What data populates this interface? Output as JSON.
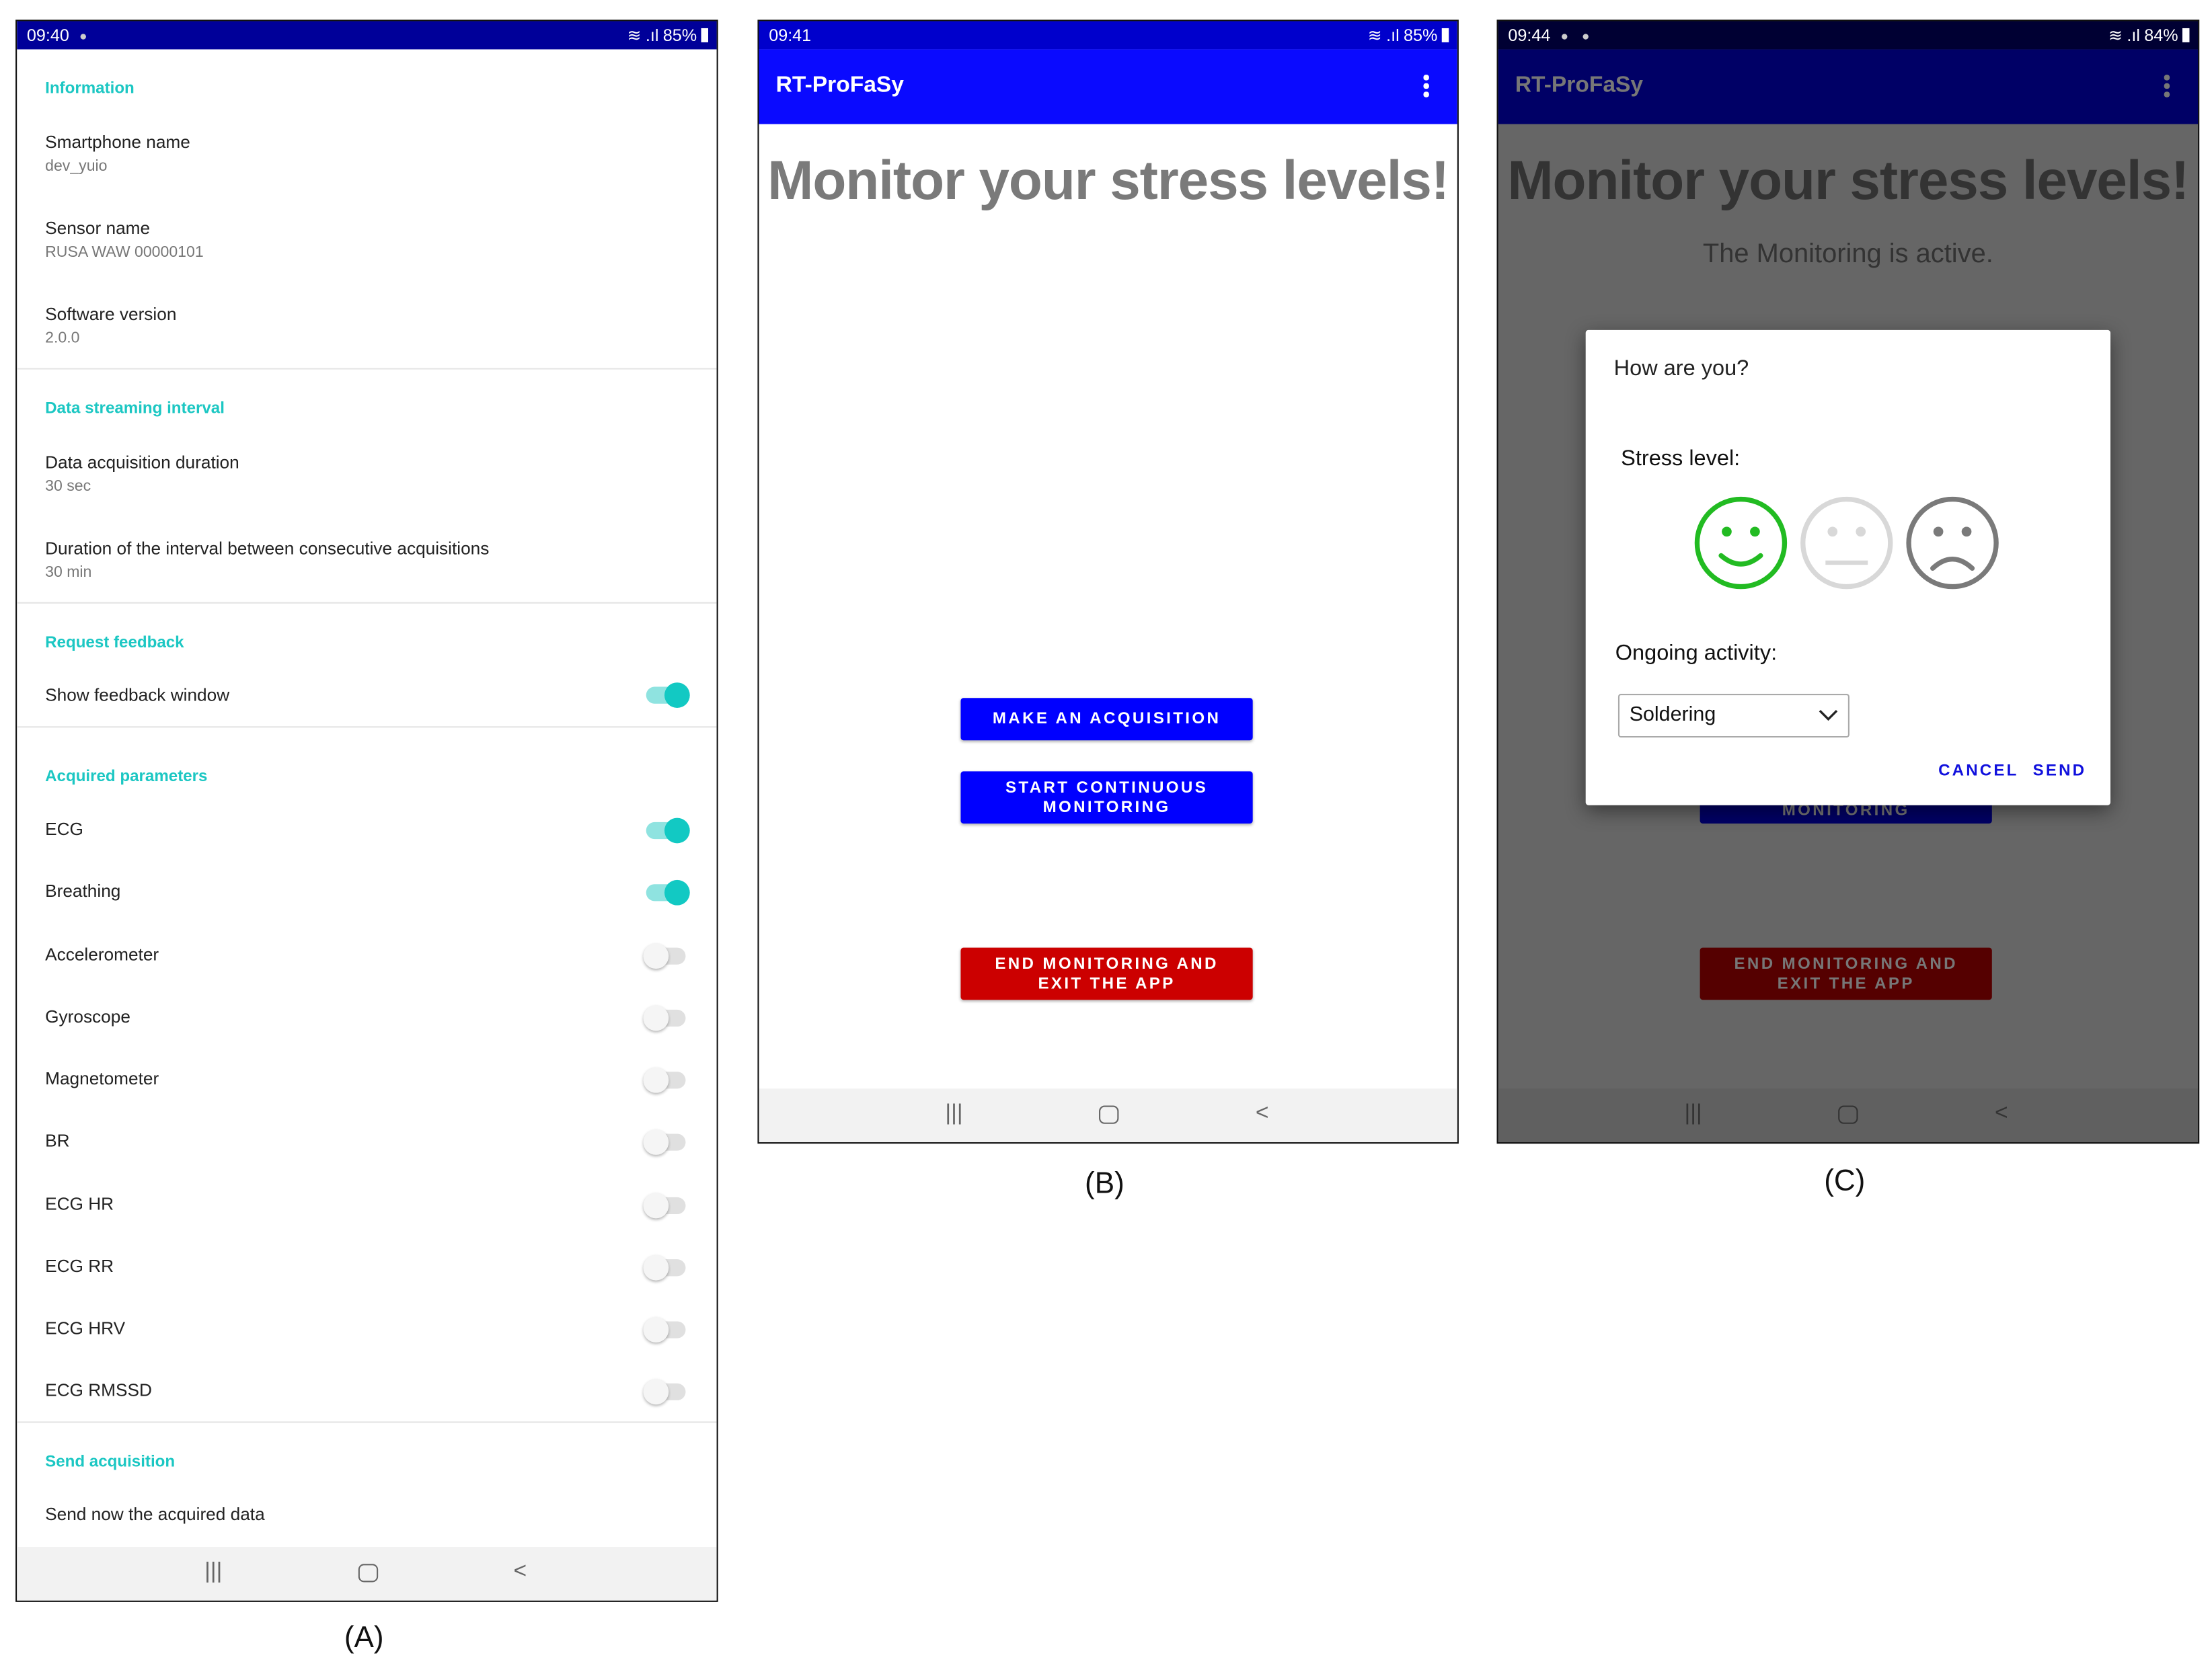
{
  "panelA": {
    "caption": "(A)",
    "status": {
      "time": "09:40",
      "battery": "85%"
    },
    "sections": {
      "information": "Information",
      "streaming": "Data streaming interval",
      "feedback": "Request feedback",
      "parameters": "Acquired parameters",
      "send": "Send acquisition"
    },
    "info": [
      {
        "title": "Smartphone name",
        "value": "dev_yuio"
      },
      {
        "title": "Sensor name",
        "value": "RUSA WAW 00000101"
      },
      {
        "title": "Software version",
        "value": "2.0.0"
      }
    ],
    "streaming": [
      {
        "title": "Data acquisition duration",
        "value": "30 sec"
      },
      {
        "title": "Duration of the interval between consecutive acquisitions",
        "value": "30 min"
      }
    ],
    "feedback_toggle": {
      "label": "Show feedback window",
      "on": true
    },
    "parameters": [
      {
        "label": "ECG",
        "on": true
      },
      {
        "label": "Breathing",
        "on": true
      },
      {
        "label": "Accelerometer",
        "on": false
      },
      {
        "label": "Gyroscope",
        "on": false
      },
      {
        "label": "Magnetometer",
        "on": false
      },
      {
        "label": "BR",
        "on": false
      },
      {
        "label": "ECG HR",
        "on": false
      },
      {
        "label": "ECG RR",
        "on": false
      },
      {
        "label": "ECG HRV",
        "on": false
      },
      {
        "label": "ECG RMSSD",
        "on": false
      }
    ],
    "send_now": "Send now the acquired data"
  },
  "panelB": {
    "caption": "(B)",
    "status": {
      "time": "09:41",
      "battery": "85%"
    },
    "app_title": "RT-ProFaSy",
    "headline": "Monitor your stress levels!",
    "buttons": {
      "acquire": "MAKE AN ACQUISITION",
      "start_1": "START CONTINUOUS",
      "start_2": "MONITORING",
      "end_1": "END MONITORING AND",
      "end_2": "EXIT THE APP"
    }
  },
  "panelC": {
    "caption": "(C)",
    "status": {
      "time": "09:44",
      "battery": "84%"
    },
    "app_title": "RT-ProFaSy",
    "headline": "Monitor your stress levels!",
    "subtitle": "The Monitoring is active.",
    "behind_button": "MONITORING",
    "behind_end_1": "END MONITORING AND",
    "behind_end_2": "EXIT THE APP",
    "dialog": {
      "title": "How are you?",
      "stress_label": "Stress level:",
      "activity_label": "Ongoing activity:",
      "activity_value": "Soldering",
      "cancel": "CANCEL",
      "send": "SEND",
      "selected_face": "happy"
    }
  },
  "colors": {
    "teal": "#1cc7c3",
    "blue": "#0000ff",
    "red": "#cc0000",
    "green": "#22bb22"
  }
}
